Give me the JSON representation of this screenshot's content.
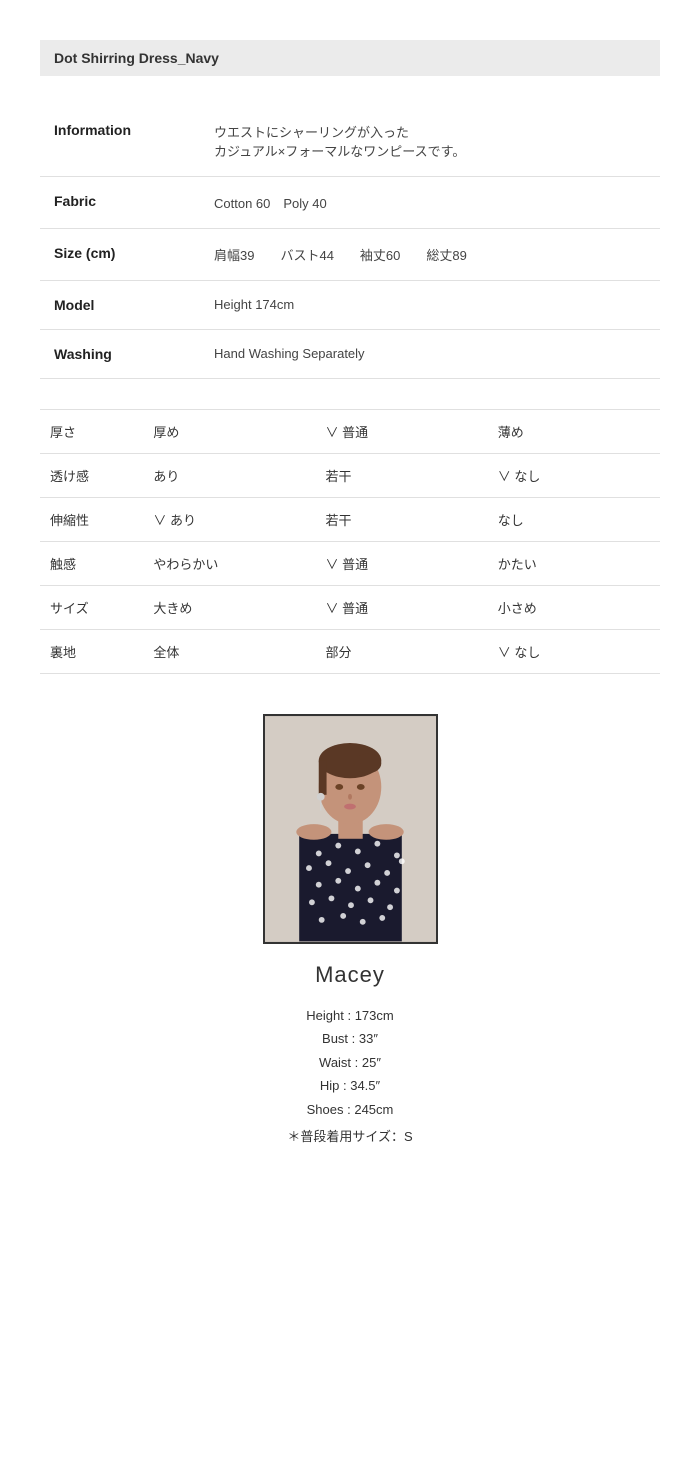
{
  "product": {
    "title": "Dot Shirring Dress_Navy",
    "rows": [
      {
        "label": "Information",
        "value_lines": [
          "ウエストにシャーリングが入った",
          "カジュアル×フォーマルなワンピースです。"
        ]
      },
      {
        "label": "Fabric",
        "value_lines": [
          "Cotton 60　Poly 40"
        ]
      },
      {
        "label": "Size (cm)",
        "value_lines": [
          "肩幅39　　バスト44　　袖丈60　　総丈89"
        ]
      },
      {
        "label": "Model",
        "value_lines": [
          "Height 174cm"
        ]
      },
      {
        "label": "Washing",
        "value_lines": [
          "Hand Washing Separately"
        ]
      }
    ]
  },
  "characteristics": [
    {
      "attr": "厚さ",
      "col1": "厚め",
      "col1_checked": false,
      "col2": "普通",
      "col2_checked": true,
      "col3": "薄め",
      "col3_checked": false
    },
    {
      "attr": "透け感",
      "col1": "あり",
      "col1_checked": false,
      "col2": "若干",
      "col2_checked": false,
      "col3": "なし",
      "col3_checked": true
    },
    {
      "attr": "伸縮性",
      "col1": "あり",
      "col1_checked": true,
      "col2": "若干",
      "col2_checked": false,
      "col3": "なし",
      "col3_checked": false
    },
    {
      "attr": "触感",
      "col1": "やわらかい",
      "col1_checked": false,
      "col2": "普通",
      "col2_checked": true,
      "col3": "かたい",
      "col3_checked": false
    },
    {
      "attr": "サイズ",
      "col1": "大きめ",
      "col1_checked": false,
      "col2": "普通",
      "col2_checked": true,
      "col3": "小さめ",
      "col3_checked": false
    },
    {
      "attr": "裏地",
      "col1": "全体",
      "col1_checked": false,
      "col2": "部分",
      "col2_checked": false,
      "col3": "なし",
      "col3_checked": true
    }
  ],
  "model": {
    "name": "Macey",
    "stats": [
      "Height : 173cm",
      "Bust : 33″",
      "Waist : 25″",
      "Hip : 34.5″",
      "Shoes : 245cm"
    ],
    "note": "＊普段着用サイズ：S"
  },
  "check_symbol": "∨"
}
